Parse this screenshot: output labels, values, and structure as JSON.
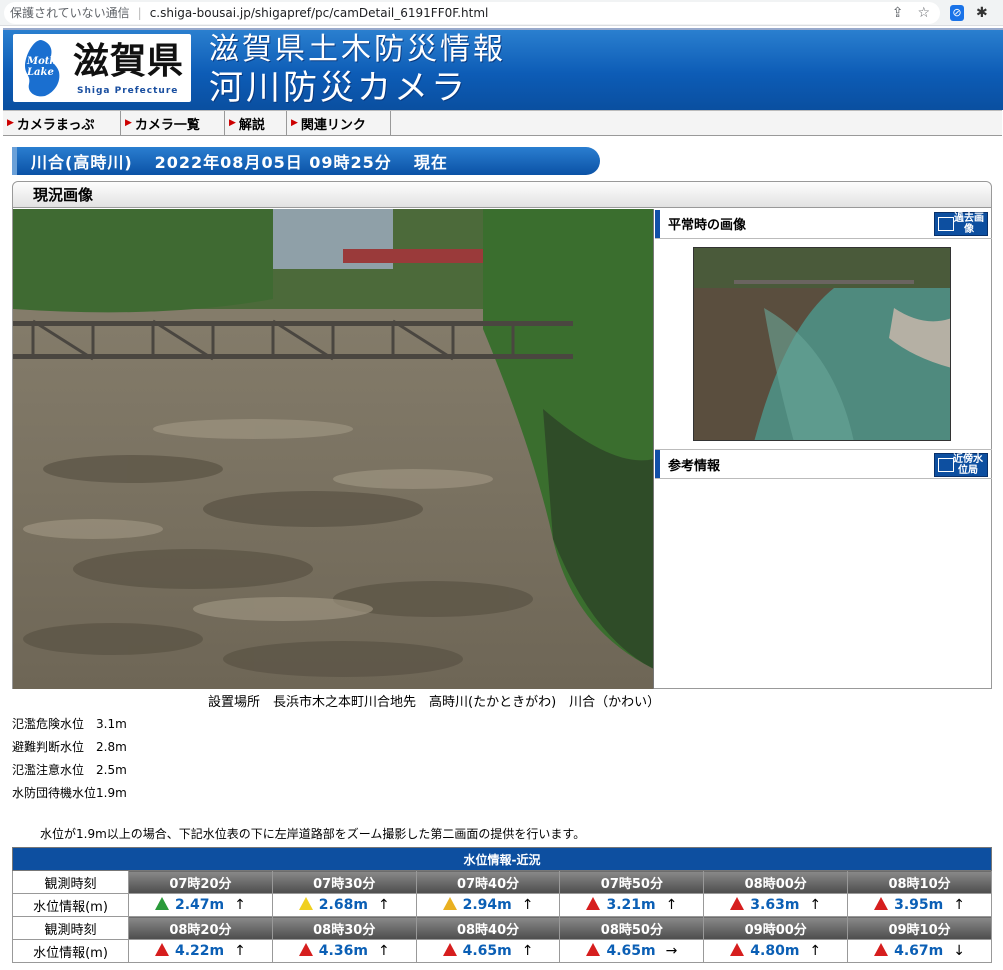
{
  "browser": {
    "security": "保護されていない通信",
    "url": "c.shiga-bousai.jp/shigapref/pc/camDetail_6191FF0F.html"
  },
  "header": {
    "logo_lake": "Mother Lake",
    "pref_name": "滋賀県",
    "pref_en": "Shiga Prefecture",
    "site_title": "滋賀県土木防災情報",
    "site_subtitle": "河川防災カメラ"
  },
  "menu": [
    {
      "label": "カメラまっぷ"
    },
    {
      "label": "カメラ一覧"
    },
    {
      "label": "解説"
    },
    {
      "label": "関連リンク"
    }
  ],
  "ribbon": {
    "station": "川合(高時川)",
    "datetime": "2022年08月05日 09時25分",
    "suffix": "現在"
  },
  "current": {
    "heading": "現況画像"
  },
  "side": {
    "normal_heading": "平常時の画像",
    "past_btn": "過去画像",
    "ref_heading": "参考情報",
    "nearby_btn": "近傍水位局"
  },
  "install": "設置場所　長浜市木之本町川合地先　高時川(たかときがわ)　川合（かわい）",
  "levels": [
    "氾濫危険水位　3.1m",
    "避難判断水位　2.8m",
    "氾濫注意水位　2.5m",
    "水防団待機水位1.9m"
  ],
  "note": "水位が1.9m以上の場合、下記水位表の下に左岸道路部をズーム撮影した第二画面の提供を行います。",
  "water_table": {
    "caption": "水位情報-近況",
    "time_label": "観測時刻",
    "value_label": "水位情報(m)",
    "rows": [
      {
        "times": [
          "07時20分",
          "07時30分",
          "07時40分",
          "07時50分",
          "08時00分",
          "08時10分"
        ],
        "values": [
          {
            "v": "2.47m",
            "arrow": "↑",
            "level": "green"
          },
          {
            "v": "2.68m",
            "arrow": "↑",
            "level": "yellow"
          },
          {
            "v": "2.94m",
            "arrow": "↑",
            "level": "orange"
          },
          {
            "v": "3.21m",
            "arrow": "↑",
            "level": "red"
          },
          {
            "v": "3.63m",
            "arrow": "↑",
            "level": "red"
          },
          {
            "v": "3.95m",
            "arrow": "↑",
            "level": "red"
          }
        ]
      },
      {
        "times": [
          "08時20分",
          "08時30分",
          "08時40分",
          "08時50分",
          "09時00分",
          "09時10分"
        ],
        "values": [
          {
            "v": "4.22m",
            "arrow": "↑",
            "level": "red"
          },
          {
            "v": "4.36m",
            "arrow": "↑",
            "level": "red"
          },
          {
            "v": "4.65m",
            "arrow": "↑",
            "level": "red"
          },
          {
            "v": "4.65m",
            "arrow": "→",
            "level": "red"
          },
          {
            "v": "4.80m",
            "arrow": "↑",
            "level": "red"
          },
          {
            "v": "4.67m",
            "arrow": "↓",
            "level": "red"
          }
        ]
      }
    ]
  }
}
